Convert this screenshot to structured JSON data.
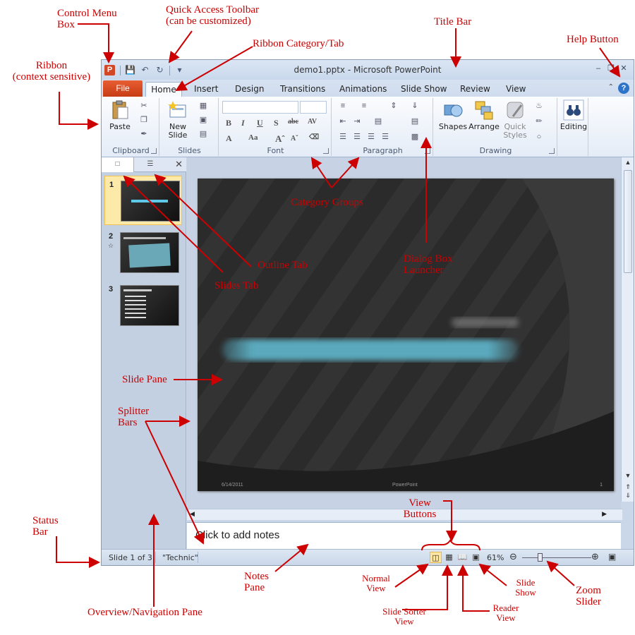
{
  "window": {
    "title": "demo1.pptx - Microsoft PowerPoint",
    "app_icon_letter": "P"
  },
  "tabs": {
    "file": "File",
    "items": [
      "Home",
      "Insert",
      "Design",
      "Transitions",
      "Animations",
      "Slide Show",
      "Review",
      "View"
    ],
    "active": "Home"
  },
  "ribbon": {
    "groups": {
      "clipboard": "Clipboard",
      "slides": "Slides",
      "font": "Font",
      "paragraph": "Paragraph",
      "drawing": "Drawing"
    },
    "buttons": {
      "paste": "Paste",
      "new_slide_1": "New",
      "new_slide_2": "Slide",
      "shapes": "Shapes",
      "arrange": "Arrange",
      "quick_styles_1": "Quick",
      "quick_styles_2": "Styles",
      "editing": "Editing"
    }
  },
  "left_pane": {
    "slides": [
      {
        "num": "1",
        "selected": true
      },
      {
        "num": "2",
        "selected": false
      },
      {
        "num": "3",
        "selected": false
      }
    ]
  },
  "slide": {
    "footer_date": "6/14/2011",
    "footer_center": "PowerPoint",
    "footer_num": "1"
  },
  "notes": {
    "placeholder": "Click to add notes"
  },
  "status": {
    "slide_info": "Slide 1 of 3",
    "theme": "\"Technic\"",
    "zoom": "61%"
  },
  "annotations": {
    "control_menu_1": "Control Menu",
    "control_menu_2": "Box",
    "qat_1": "Quick Access Toolbar",
    "qat_2": "(can be customized)",
    "title_bar": "Title Bar",
    "ribbon_tab": "Ribbon Category/Tab",
    "help_button": "Help Button",
    "ribbon_1": "Ribbon",
    "ribbon_2": "(context sensitive)",
    "category_groups": "Category Groups",
    "outline_tab": "Outline Tab",
    "slides_tab": "Slides Tab",
    "dialog_1": "Dialog Box",
    "dialog_2": "Launcher",
    "slide_pane": "Slide Pane",
    "splitter_1": "Splitter",
    "splitter_2": "Bars",
    "view_buttons_1": "View",
    "view_buttons_2": "Buttons",
    "status_1": "Status",
    "status_2": "Bar",
    "notes_1": "Notes",
    "notes_2": "Pane",
    "normal_1": "Normal",
    "normal_2": "View",
    "slide_show_1": "Slide",
    "slide_show_2": "Show",
    "zoom_1": "Zoom",
    "zoom_2": "Slider",
    "reader_1": "Reader",
    "reader_2": "View",
    "sorter_1": "Slide Sorter",
    "sorter_2": "View",
    "overview": "Overview/Navigation Pane"
  },
  "colors": {
    "annotation": "#cc0000",
    "file_tab": "#d24726",
    "ribbon_bg": "#e4ecf7",
    "selected_thumb": "#fde9a8"
  }
}
